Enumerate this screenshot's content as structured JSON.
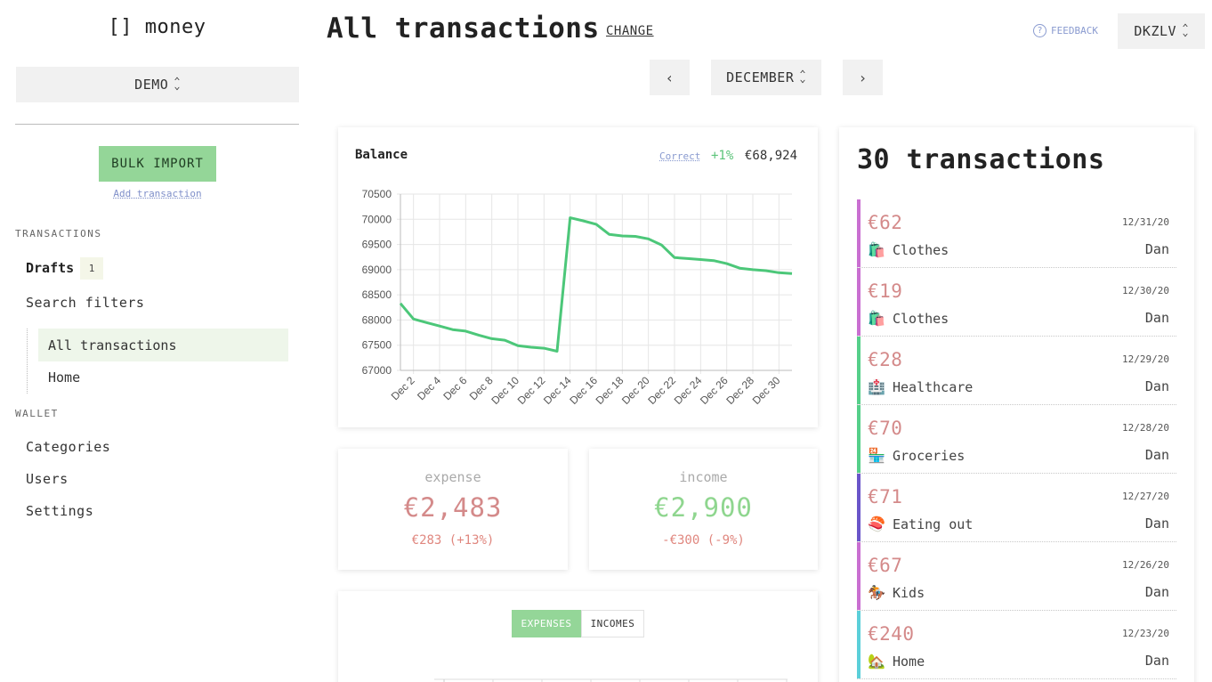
{
  "app": {
    "logo": "[] money"
  },
  "sidebar": {
    "wallet_select": "DEMO",
    "bulk_import": "BULK IMPORT",
    "add_transaction": "Add transaction",
    "transactions_label": "TRANSACTIONS",
    "drafts_label": "Drafts",
    "drafts_count": "1",
    "search_filters": "Search filters",
    "filters": [
      "All transactions",
      "Home"
    ],
    "wallet_label": "WALLET",
    "wallet_items": [
      "Categories",
      "Users",
      "Settings"
    ]
  },
  "header": {
    "title": "All transactions",
    "change": "CHANGE",
    "feedback": "FEEDBACK",
    "currency": "DKZLV",
    "prev": "‹",
    "month": "DECEMBER",
    "next": "›"
  },
  "balance": {
    "title": "Balance",
    "correct": "Correct",
    "pct": "+1%",
    "value": "€68,924"
  },
  "chart_data": {
    "type": "line",
    "x": [
      "Dec 1",
      "Dec 2",
      "Dec 3",
      "Dec 4",
      "Dec 5",
      "Dec 6",
      "Dec 7",
      "Dec 8",
      "Dec 9",
      "Dec 10",
      "Dec 11",
      "Dec 12",
      "Dec 13",
      "Dec 14",
      "Dec 15",
      "Dec 16",
      "Dec 17",
      "Dec 18",
      "Dec 19",
      "Dec 20",
      "Dec 21",
      "Dec 22",
      "Dec 23",
      "Dec 24",
      "Dec 25",
      "Dec 26",
      "Dec 27",
      "Dec 28",
      "Dec 29",
      "Dec 30",
      "Dec 31"
    ],
    "tick_labels": [
      "Dec 2",
      "Dec 4",
      "Dec 6",
      "Dec 8",
      "Dec 10",
      "Dec 12",
      "Dec 14",
      "Dec 16",
      "Dec 18",
      "Dec 20",
      "Dec 22",
      "Dec 24",
      "Dec 26",
      "Dec 28",
      "Dec 30"
    ],
    "values": [
      68330,
      68020,
      67950,
      67880,
      67810,
      67780,
      67700,
      67630,
      67600,
      67490,
      67460,
      67440,
      67380,
      70030,
      69970,
      69900,
      69700,
      69670,
      69660,
      69610,
      69490,
      69240,
      69220,
      69200,
      69180,
      69120,
      69030,
      69000,
      68980,
      68940,
      68924
    ],
    "ylim": [
      67000,
      70500
    ],
    "yticks": [
      67000,
      67500,
      68000,
      68500,
      69000,
      69500,
      70000,
      70500
    ],
    "grid": true,
    "color": "#4cc779",
    "title": "Balance"
  },
  "stats": {
    "expense_label": "expense",
    "expense_value": "€2,483",
    "expense_delta": "€283 (+13%)",
    "income_label": "income",
    "income_value": "€2,900",
    "income_delta": "-€300 (-9%)",
    "expense_color": "#d48a8a",
    "income_color": "#8fd68f"
  },
  "toggles": {
    "expenses": "EXPENSES",
    "incomes": "INCOMES"
  },
  "transactions": {
    "heading": "30 transactions",
    "items": [
      {
        "amount": "€62",
        "date": "12/31/20",
        "icon": "🛍️",
        "category": "Clothes",
        "user": "Dan",
        "color": "#c96fd1"
      },
      {
        "amount": "€19",
        "date": "12/30/20",
        "icon": "🛍️",
        "category": "Clothes",
        "user": "Dan",
        "color": "#c96fd1"
      },
      {
        "amount": "€28",
        "date": "12/29/20",
        "icon": "🏥",
        "category": "Healthcare",
        "user": "Dan",
        "color": "#55cf8a"
      },
      {
        "amount": "€70",
        "date": "12/28/20",
        "icon": "🏪",
        "category": "Groceries",
        "user": "Dan",
        "color": "#55cf8a"
      },
      {
        "amount": "€71",
        "date": "12/27/20",
        "icon": "🍣",
        "category": "Eating out",
        "user": "Dan",
        "color": "#6a55c9"
      },
      {
        "amount": "€67",
        "date": "12/26/20",
        "icon": "🏇",
        "category": "Kids",
        "user": "Dan",
        "color": "#c96fd1"
      },
      {
        "amount": "€240",
        "date": "12/23/20",
        "icon": "🏡",
        "category": "Home",
        "user": "Dan",
        "color": "#5bcfd9"
      }
    ]
  }
}
